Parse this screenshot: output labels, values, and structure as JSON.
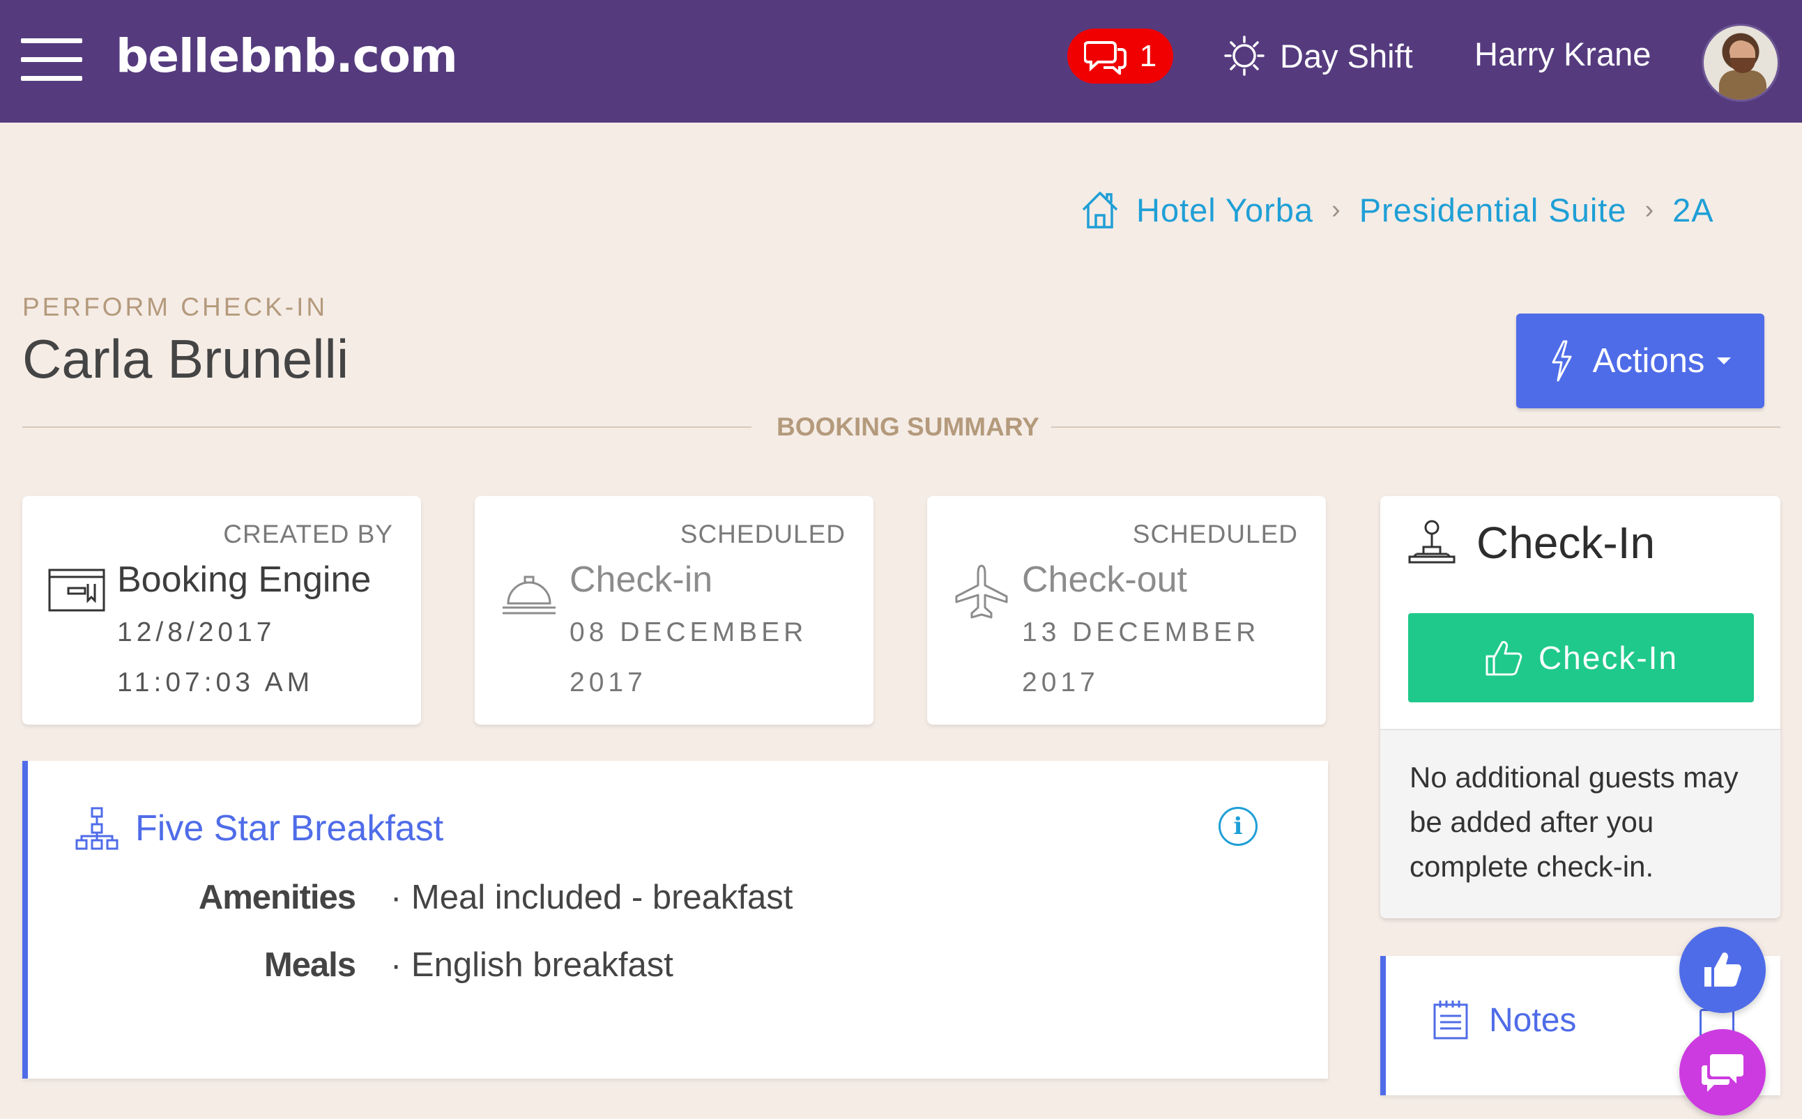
{
  "app": {
    "brand": "bellebnb.com",
    "message_count": "1",
    "shift_label": "Day Shift",
    "user_name": "Harry Krane"
  },
  "breadcrumb": {
    "items": [
      "Hotel Yorba",
      "Presidential Suite",
      "2A"
    ],
    "separator": "›"
  },
  "header": {
    "kicker": "PERFORM CHECK-IN",
    "guest_name": "Carla Brunelli",
    "actions_label": "Actions",
    "section_label": "BOOKING SUMMARY"
  },
  "cards": [
    {
      "caption": "CREATED BY",
      "main": "Booking Engine",
      "line1": "12/8/2017",
      "line2": "11:07:03 AM",
      "icon": "booking-engine-icon"
    },
    {
      "caption": "SCHEDULED",
      "main": "Check-in",
      "line1": "08 DECEMBER",
      "line2": "2017",
      "icon": "service-bell-icon"
    },
    {
      "caption": "SCHEDULED",
      "main": "Check-out",
      "line1": "13 DECEMBER",
      "line2": "2017",
      "icon": "airplane-icon"
    }
  ],
  "package": {
    "name": "Five Star Breakfast",
    "info_glyph": "i",
    "rows": [
      {
        "key": "Amenities",
        "value": "· Meal included - breakfast"
      },
      {
        "key": "Meals",
        "value": "· English breakfast"
      }
    ]
  },
  "checkin": {
    "title": "Check-In",
    "button_label": "Check-In",
    "note": "No additional guests may be added after you complete check-in."
  },
  "notes": {
    "title": "Notes"
  },
  "colors": {
    "topbar": "#553b7e",
    "accent": "#4f6ce8",
    "link": "#1f9fd6",
    "success": "#1fc98c",
    "badge": "#f00000",
    "chat": "#cc3be0",
    "background": "#f5ece6"
  }
}
